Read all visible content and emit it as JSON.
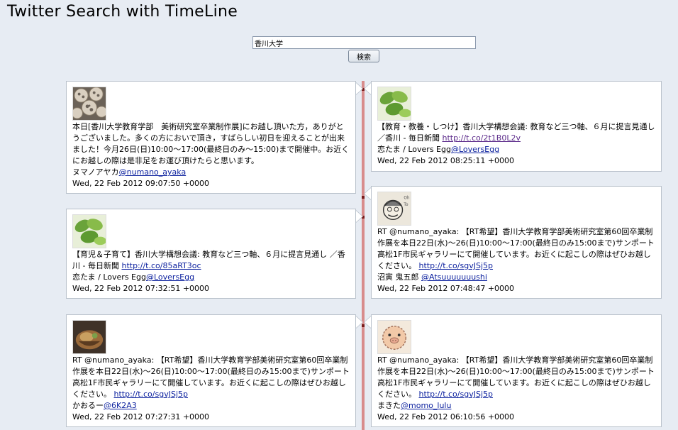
{
  "page": {
    "title": "Twitter Search with TimeLine"
  },
  "search": {
    "value": "香川大学",
    "button_label": "検索"
  },
  "colors": {
    "timeline": "#d88c8c",
    "link": "#0a1f9e",
    "background": "#e7ecf3"
  },
  "tweets": [
    {
      "avatar_icon": "lotus-root-icon",
      "text": "本日[香川大学教育学部　美術研究室卒業制作展]にお越し頂いた方，ありがとうございました。多くの方においで頂き，すばらしい初日を迎えることが出来ました！今月26日(日)10:00〜17:00(最終日のみ〜15:00)まで開催中。お近くにお越しの際は是非足をお運び頂けたらと思います。",
      "link": "",
      "user_name": "ヌマノアヤカ",
      "user_handle": "@numano_ayaka",
      "date": "Wed, 22 Feb 2012 09:07:50 +0000"
    },
    {
      "avatar_icon": "green-leaves-icon",
      "text": "【教育・教養・しつけ】香川大学構想会議: 教育など三つ軸、６月に提言見通し ／香川 - 毎日新聞",
      "link": "http://t.co/2t1B0L2v",
      "user_name": "恋たま / Lovers Egg",
      "user_handle": "@LoversEgg",
      "date": "Wed, 22 Feb 2012 08:25:11 +0000"
    },
    {
      "avatar_icon": "cartoon-face-icon",
      "text": "RT @numano_ayaka: 【RT希望】香川大学教育学部美術研究室第60回卒業制作展を本日22日(水)〜26(日)10:00〜17:00(最終日のみ15:00まで)サンポート高松1F市民ギャラリーにて開催しています。お近くに起こしの際はぜひお越しください。",
      "link": "http://t.co/sgvJSj5p",
      "user_name": "沼寅 鬼五郎 ",
      "user_handle": "@Atsuuuuuuushi",
      "date": "Wed, 22 Feb 2012 07:48:47 +0000"
    },
    {
      "avatar_icon": "green-leaves-icon",
      "text": "【育児＆子育て】香川大学構想会議: 教育など三つ軸、６月に提言見通し ／香川 - 毎日新聞",
      "link": "http://t.co/85aRT3oc",
      "user_name": "恋たま / Lovers Egg",
      "user_handle": "@LoversEgg",
      "date": "Wed, 22 Feb 2012 07:32:51 +0000"
    },
    {
      "avatar_icon": "food-dish-icon",
      "text": "RT @numano_ayaka: 【RT希望】香川大学教育学部美術研究室第60回卒業制作展を本日22日(水)〜26(日)10:00〜17:00(最終日のみ15:00まで)サンポート高松1F市民ギャラリーにて開催しています。お近くに起こしの際はぜひお越しください。",
      "link": "http://t.co/sgvJSj5p",
      "user_name": "かおるー",
      "user_handle": "@6K2A3",
      "date": "Wed, 22 Feb 2012 07:27:31 +0000"
    },
    {
      "avatar_icon": "pig-face-icon",
      "text": "RT @numano_ayaka: 【RT希望】香川大学教育学部美術研究室第60回卒業制作展を本日22日(水)〜26(日)10:00〜17:00(最終日のみ15:00まで)サンポート高松1F市民ギャラリーにて開催しています。お近くに起こしの際はぜひお越しください。",
      "link": "http://t.co/sgvJSj5p",
      "user_name": "まきた",
      "user_handle": "@momo_lulu",
      "date": "Wed, 22 Feb 2012 06:10:56 +0000"
    }
  ]
}
